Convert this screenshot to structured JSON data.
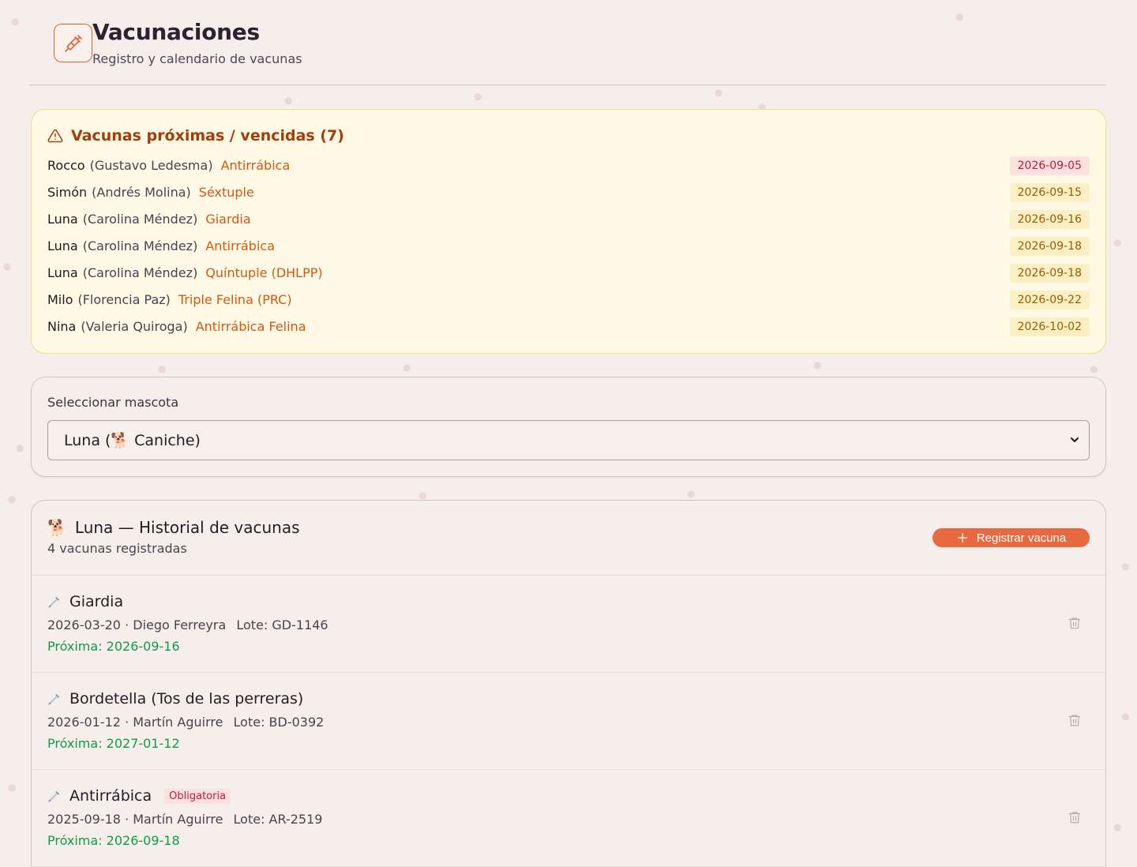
{
  "header": {
    "title": "Vacunaciones",
    "subtitle": "Registro y calendario de vacunas",
    "icon": "syringe-icon"
  },
  "alerts": {
    "title": "Vacunas próximas / vencidas (7)",
    "icon": "warning-icon",
    "items": [
      {
        "pet": "Rocco",
        "owner": "(Gustavo Ledesma)",
        "vaccine": "Antirrábica",
        "date": "2026-09-05",
        "status": "overdue"
      },
      {
        "pet": "Simón",
        "owner": "(Andrés Molina)",
        "vaccine": "Séxtuple",
        "date": "2026-09-15",
        "status": "upcoming"
      },
      {
        "pet": "Luna",
        "owner": "(Carolina Méndez)",
        "vaccine": "Giardia",
        "date": "2026-09-16",
        "status": "upcoming"
      },
      {
        "pet": "Luna",
        "owner": "(Carolina Méndez)",
        "vaccine": "Antirrábica",
        "date": "2026-09-18",
        "status": "upcoming"
      },
      {
        "pet": "Luna",
        "owner": "(Carolina Méndez)",
        "vaccine": "Quíntuple (DHLPP)",
        "date": "2026-09-18",
        "status": "upcoming"
      },
      {
        "pet": "Milo",
        "owner": "(Florencia Paz)",
        "vaccine": "Triple Felina (PRC)",
        "date": "2026-09-22",
        "status": "upcoming"
      },
      {
        "pet": "Nina",
        "owner": "(Valeria Quiroga)",
        "vaccine": "Antirrábica Felina",
        "date": "2026-10-02",
        "status": "upcoming"
      }
    ]
  },
  "selector": {
    "label": "Seleccionar mascota",
    "selected": "Luna (🐕 Caniche)"
  },
  "history": {
    "title": "Luna — Historial de vacunas",
    "pet_icon": "🐕",
    "count": "4 vacunas registradas",
    "register_label": "Registrar vacuna",
    "items": [
      {
        "name": "Giardia",
        "badge": "",
        "meta": "2026-03-20 · Diego Ferreyra",
        "lote": "Lote: GD-1146",
        "next": "Próxima: 2026-09-16"
      },
      {
        "name": "Bordetella (Tos de las perreras)",
        "badge": "",
        "meta": "2026-01-12 · Martín Aguirre",
        "lote": "Lote: BD-0392",
        "next": "Próxima: 2027-01-12"
      },
      {
        "name": "Antirrábica",
        "badge": "Obligatoria",
        "meta": "2025-09-18 · Martín Aguirre",
        "lote": "Lote: AR-2519",
        "next": "Próxima: 2026-09-18"
      }
    ]
  },
  "colors": {
    "accent": "#e8683f",
    "overdue": "#c21d2e",
    "upcoming": "#9a5b00",
    "next": "#0f9c4a"
  }
}
